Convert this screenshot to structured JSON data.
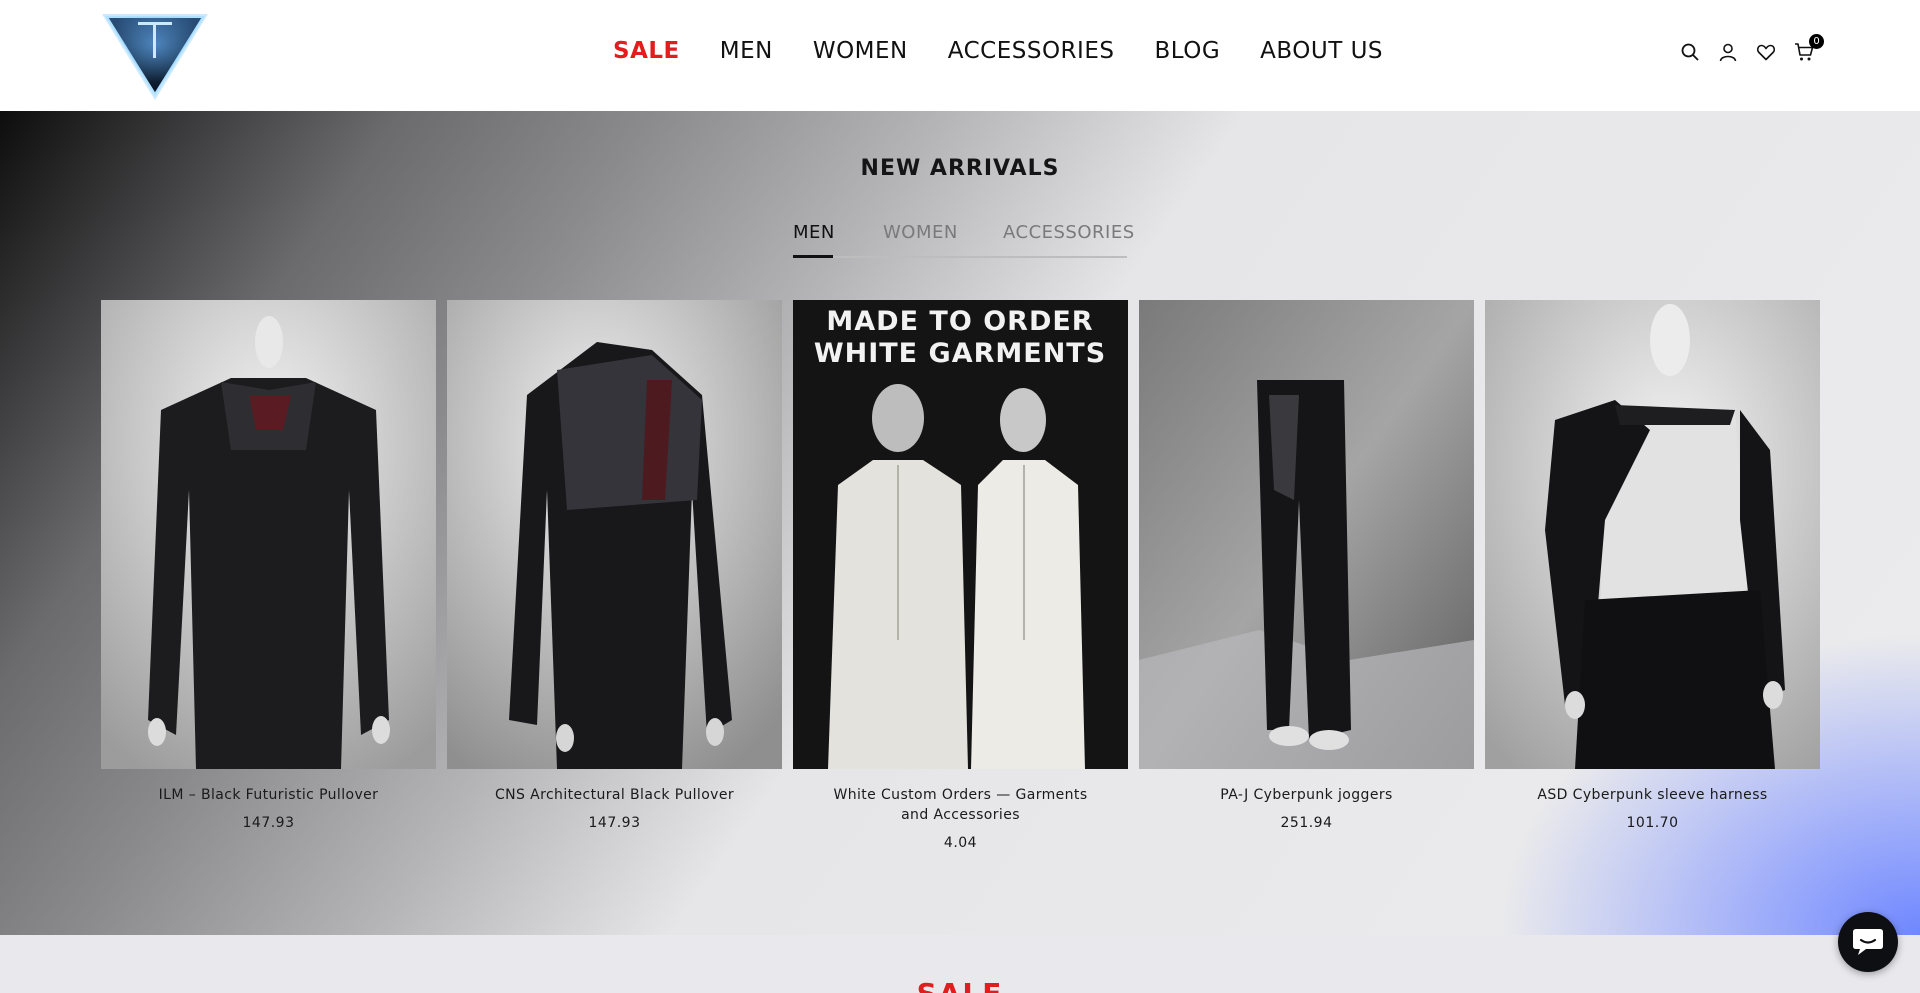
{
  "header": {
    "nav": [
      {
        "label": "SALE",
        "color": "#e21d1d"
      },
      {
        "label": "MEN"
      },
      {
        "label": "WOMEN"
      },
      {
        "label": "ACCESSORIES"
      },
      {
        "label": "BLOG"
      },
      {
        "label": "ABOUT US"
      }
    ],
    "icons": [
      "search-icon",
      "account-icon",
      "wishlist-heart-icon",
      "cart-icon"
    ],
    "cart_count": "0"
  },
  "new_arrivals": {
    "title": "NEW ARRIVALS",
    "tabs": [
      {
        "label": "MEN",
        "active": true
      },
      {
        "label": "WOMEN",
        "active": false
      },
      {
        "label": "ACCESSORIES",
        "active": false
      }
    ],
    "products": [
      {
        "name": "ILM – Black Futuristic Pullover",
        "price": "147.93"
      },
      {
        "name": "CNS Architectural Black Pullover",
        "price": "147.93"
      },
      {
        "name": "White Custom Orders — Garments and Accessories",
        "price": "4.04",
        "image_text": "MADE TO ORDER\nWHITE GARMENTS"
      },
      {
        "name": "PA-J Cyberpunk joggers",
        "price": "251.94"
      },
      {
        "name": "ASD Cyberpunk sleeve harness",
        "price": "101.70"
      }
    ]
  },
  "sale_section": {
    "title": "SALE"
  },
  "chat": {
    "icon": "chat-bubble-icon"
  },
  "colors": {
    "accent_red": "#e21d1d",
    "gradient_blue": "#6f87ff"
  }
}
